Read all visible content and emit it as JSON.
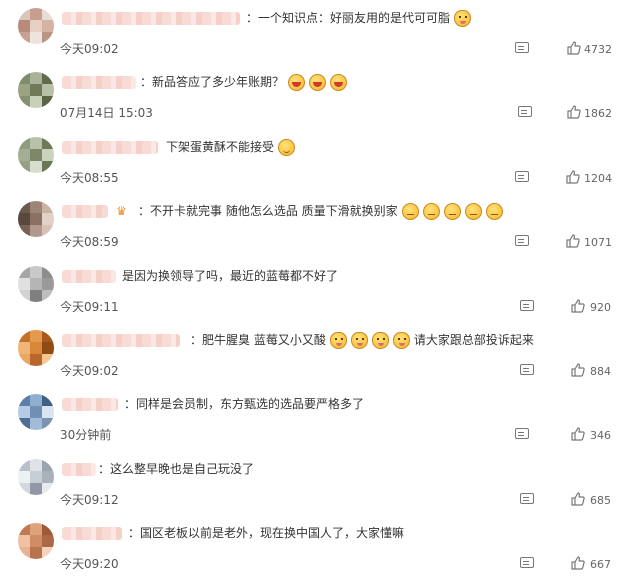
{
  "colors": {
    "text": "#333333",
    "meta": "#555555",
    "icon": "#777777",
    "name_blur": "#f6d7cf"
  },
  "comments": [
    {
      "text": "：一个知识点：好丽友用的是代可可脂",
      "time": "今天09:02",
      "likes": "4732",
      "emojis": [
        "cat"
      ],
      "badge": false
    },
    {
      "text": "：新品答应了多少年账期？",
      "time": "07月14日 15:03",
      "likes": "1862",
      "emojis": [
        "laugh",
        "laugh",
        "laugh"
      ],
      "badge": false
    },
    {
      "text": "下架蛋黄酥不能接受",
      "time": "今天08:55",
      "likes": "1204",
      "emojis": [
        "smile"
      ],
      "badge": false
    },
    {
      "text": "：不开卡就完事 随他怎么选品 质量下滑就换别家",
      "time": "今天08:59",
      "likes": "1071",
      "emojis": [
        "meh",
        "meh",
        "meh",
        "meh",
        "meh"
      ],
      "badge": true
    },
    {
      "text": "是因为换领导了吗，最近的蓝莓都不好了",
      "time": "今天09:11",
      "likes": "920",
      "emojis": [],
      "badge": false
    },
    {
      "text": "：肥牛腥臭 蓝莓又小又酸",
      "text_after": "请大家跟总部投诉起来",
      "time": "今天09:02",
      "likes": "884",
      "emojis": [
        "cat",
        "cat",
        "cat",
        "cat"
      ],
      "badge": false
    },
    {
      "text": "：同样是会员制，东方甄选的选品要严格多了",
      "time": "30分钟前",
      "likes": "346",
      "emojis": [],
      "badge": false
    },
    {
      "text": "：这么整早晚也是自己玩没了",
      "time": "今天09:12",
      "likes": "685",
      "emojis": [],
      "badge": false
    },
    {
      "text": "：国区老板以前是老外，现在换中国人了，大家懂嘛",
      "time": "今天09:20",
      "likes": "667",
      "emojis": [],
      "badge": false
    }
  ]
}
